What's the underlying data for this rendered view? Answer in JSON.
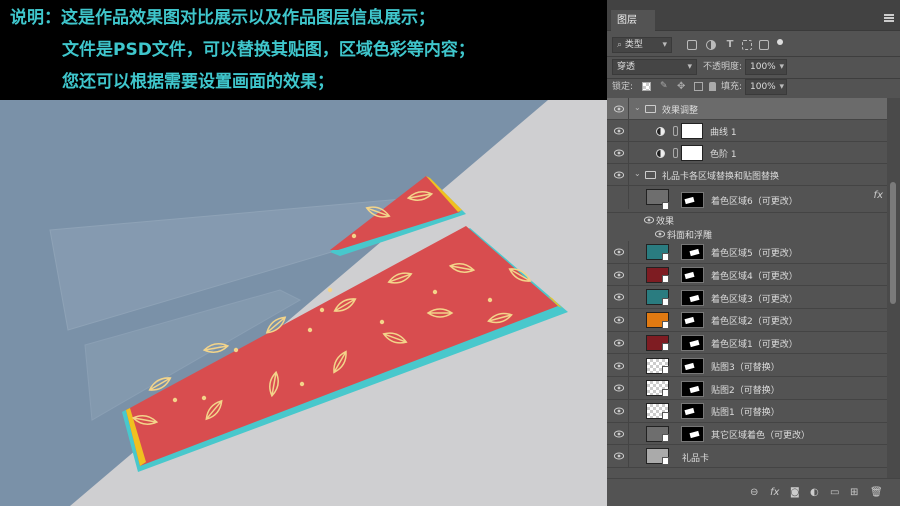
{
  "caption": {
    "line1": "说明：这是作品效果图对比展示以及作品图层信息展示；",
    "line2": "文件是PSD文件，可以替换其贴图，区域色彩等内容；",
    "line3": "您还可以根据需要设置画面的效果；",
    "color": "#3fc6cc"
  },
  "colors": {
    "card_red": "#d84d4f",
    "edge_teal": "#48c8cc",
    "edge_yellow": "#f0c020",
    "leaf": "#f3d48a",
    "bg_blue": "#7a91a8",
    "bg_grey": "#cfcfd1"
  },
  "panel": {
    "tab_label": "图层",
    "filter": {
      "kind_label": "类型"
    },
    "blend": {
      "mode": "穿透",
      "opacity_label": "不透明度:",
      "opacity_value": "100%"
    },
    "lock": {
      "label": "锁定:",
      "fill_label": "填充:",
      "fill_value": "100%"
    },
    "layers": [
      {
        "name": "效果调整",
        "type": "group-open"
      },
      {
        "name": "曲线 1",
        "type": "adjust"
      },
      {
        "name": "色阶 1",
        "type": "adjust"
      },
      {
        "name": "礼品卡各区域替换和贴图替换",
        "type": "group-open"
      },
      {
        "name": "着色区域6（可更改）",
        "type": "fill",
        "swatch": "#6e6e6e",
        "fx": "fx"
      },
      {
        "name": "效果",
        "type": "effects-label"
      },
      {
        "name": "斜面和浮雕",
        "type": "effect"
      },
      {
        "name": "着色区域5（可更改）",
        "type": "fill",
        "swatch": "#2a7c80"
      },
      {
        "name": "着色区域4（可更改）",
        "type": "fill",
        "swatch": "#7e1c22"
      },
      {
        "name": "着色区域3（可更改）",
        "type": "fill",
        "swatch": "#2a7c80"
      },
      {
        "name": "着色区域2（可更改）",
        "type": "fill",
        "swatch": "#e07a12"
      },
      {
        "name": "着色区域1（可更改）",
        "type": "fill",
        "swatch": "#7e1c22"
      },
      {
        "name": "贴图3（可替换）",
        "type": "smart"
      },
      {
        "name": "贴图2（可替换）",
        "type": "smart"
      },
      {
        "name": "贴图1（可替换）",
        "type": "smart"
      },
      {
        "name": "其它区域着色（可更改）",
        "type": "fill",
        "swatch": "#6e6e6e"
      },
      {
        "name": "礼品卡",
        "type": "plain",
        "swatch": "#aaaaaa"
      }
    ],
    "bottom_icons": [
      "link-icon",
      "fx-icon",
      "mask-icon",
      "adjustment-icon",
      "folder-icon",
      "new-layer-icon",
      "trash-icon"
    ]
  }
}
